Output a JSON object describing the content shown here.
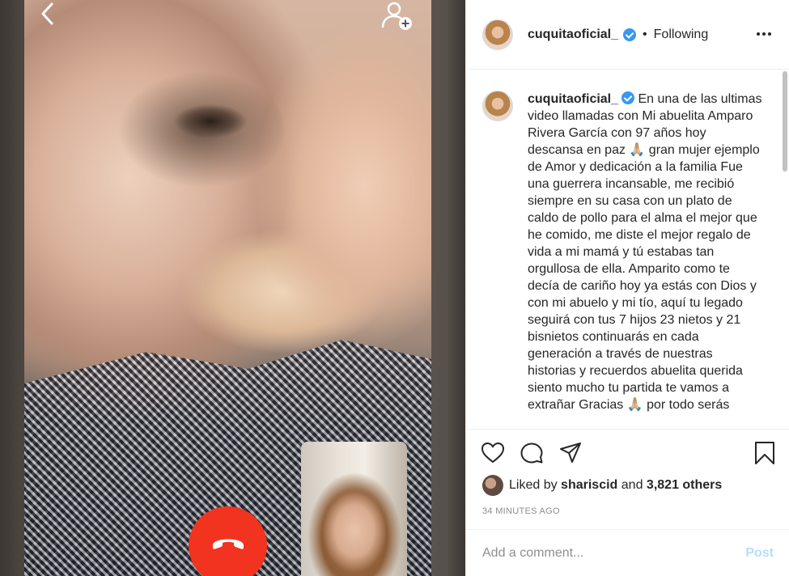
{
  "post": {
    "username": "cuquitaoficial_",
    "follow_status": "Following",
    "separator": "•",
    "caption": "En una de las ultimas video llamadas con Mi abuelita Amparo Rivera García con 97 años hoy descansa en paz 🙏🏼 gran mujer ejemplo de Amor y dedicación a la familia Fue una guerrera incansable, me recibió siempre en su casa con un plato de caldo de pollo para el alma el mejor que he comido, me diste el mejor regalo de vida a mi mamá y tú estabas tan orgullosa de ella. Amparito como te decía de cariño hoy ya estás con Dios y con mi abuelo y mi tío, aquí tu legado seguirá con tus 7 hijos 23 nietos y 21 bisnietos continuarás en cada generación a través de nuestras historias y recuerdos abuelita querida siento mucho tu partida te vamos a extrañar Gracias 🙏🏼 por todo serás",
    "likes": {
      "prefix": "Liked by",
      "user": "shariscid",
      "connector": "and",
      "count": "3,821 others"
    },
    "time_ago": "34 MINUTES AGO"
  },
  "comment": {
    "placeholder": "Add a comment...",
    "post_label": "Post"
  },
  "icons": [
    "back-icon",
    "add-person-icon",
    "end-call-icon",
    "more-icon",
    "heart-icon",
    "comment-icon",
    "share-icon",
    "bookmark-icon",
    "verified-icon"
  ],
  "colors": {
    "verified": "#3897f0",
    "end_call": "#f2331f",
    "post_button": "#b2dffc",
    "muted_text": "#8e8e8e"
  }
}
